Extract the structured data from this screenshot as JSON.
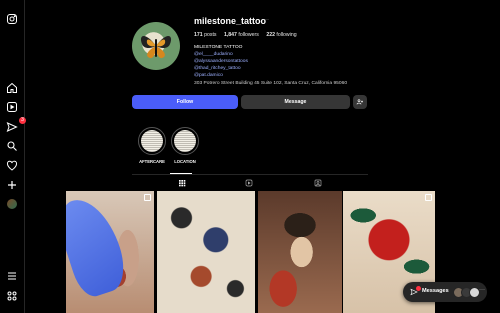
{
  "profile": {
    "username": "milestone_tattoo",
    "more": "···",
    "stats": [
      {
        "value": "171",
        "label": " posts"
      },
      {
        "value": "1,847",
        "label": " followers"
      },
      {
        "value": "222",
        "label": " following"
      }
    ],
    "bio": {
      "name": "MILESTONE TATTOO",
      "links": [
        "@el____dudarino",
        "@alyssaandersontattoos",
        "@thad_ritchey_tattoo",
        "@pat.damico"
      ],
      "address": "303 Potrero Street Building 45 Suite 102, Santa Cruz, California 95060"
    },
    "buttons": {
      "follow": "Follow",
      "message": "Message"
    }
  },
  "highlights": [
    {
      "label": "AFTERCARE"
    },
    {
      "label": "LOCATION"
    }
  ],
  "tabs": [
    {
      "name": "posts",
      "icon": "grid-icon",
      "active": true
    },
    {
      "name": "reels",
      "icon": "reels-icon",
      "active": false
    },
    {
      "name": "tagged",
      "icon": "tagged-icon",
      "active": false
    }
  ],
  "sidebar": {
    "items": [
      {
        "name": "instagram-logo",
        "icon": "instagram-icon"
      },
      {
        "name": "home",
        "icon": "home-icon"
      },
      {
        "name": "reels",
        "icon": "reels-icon"
      },
      {
        "name": "messages",
        "icon": "send-icon",
        "badge": "3"
      },
      {
        "name": "search",
        "icon": "search-icon"
      },
      {
        "name": "notifications",
        "icon": "heart-icon"
      },
      {
        "name": "create",
        "icon": "plus-icon"
      },
      {
        "name": "profile",
        "icon": "avatar"
      },
      {
        "name": "more",
        "icon": "menu-icon"
      },
      {
        "name": "meta",
        "icon": "threads-icon"
      }
    ]
  },
  "messages_bar": {
    "label": "Messages",
    "more": "···"
  },
  "colors": {
    "accent": "#4a5df9",
    "badge": "#ff3040",
    "background": "#000000"
  }
}
